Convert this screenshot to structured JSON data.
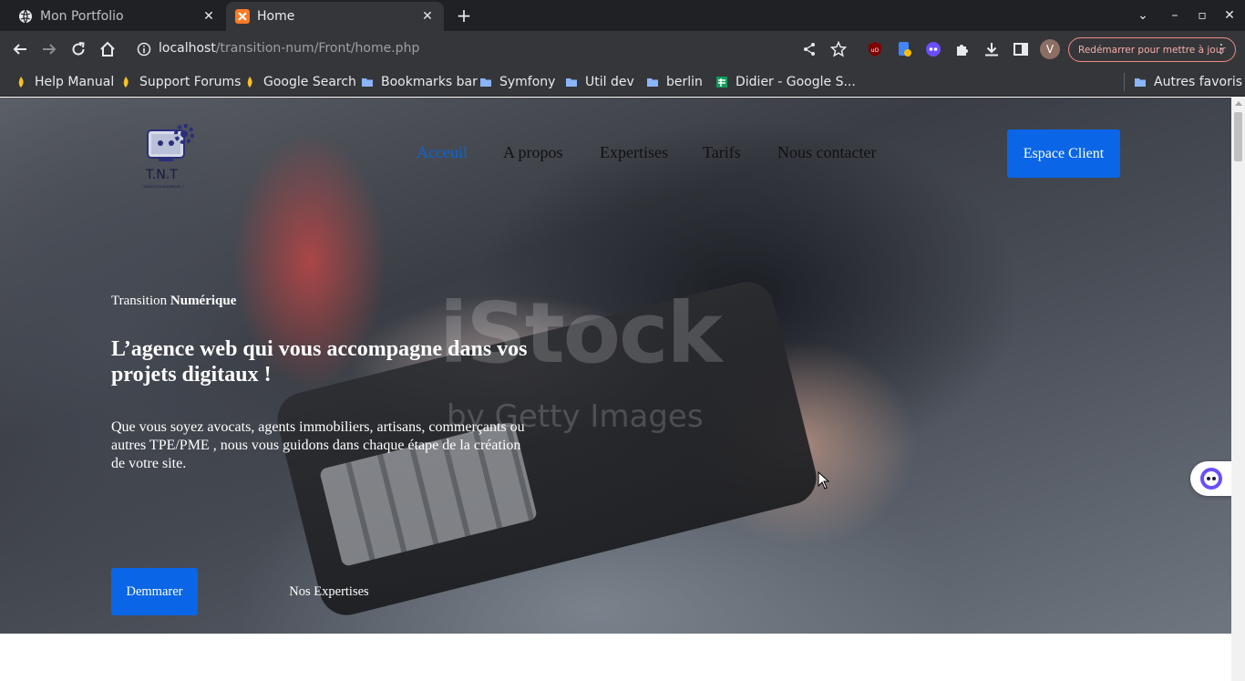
{
  "browser": {
    "tabs": [
      {
        "title": "Mon Portfolio",
        "active": false,
        "favicon": "globe-icon"
      },
      {
        "title": "Home",
        "active": true,
        "favicon": "xampp-icon"
      }
    ],
    "new_tab_symbol": "+",
    "address": {
      "host": "localhost",
      "path": "/transition-num/Front/home.php"
    },
    "restart_label": "Redémarrer pour mettre à jour",
    "profile_initial": "V",
    "bookmarks": [
      {
        "label": "Help Manual",
        "icon": "bookmark-flame-icon"
      },
      {
        "label": "Support Forums",
        "icon": "bookmark-flame-icon"
      },
      {
        "label": "Google Search",
        "icon": "bookmark-flame-icon"
      },
      {
        "label": "Bookmarks bar",
        "icon": "folder-icon"
      },
      {
        "label": "Symfony",
        "icon": "folder-icon"
      },
      {
        "label": "Util dev",
        "icon": "folder-icon"
      },
      {
        "label": "berlin",
        "icon": "folder-icon"
      },
      {
        "label": "Didier - Google S...",
        "icon": "sheets-icon"
      }
    ],
    "other_bookmarks": "Autres favoris"
  },
  "site": {
    "logo_text": "T.N.T",
    "logo_subtitle": "TRANSITION NUMÉRIQUE T",
    "nav": [
      {
        "label": "Acceuil",
        "active": true
      },
      {
        "label": "A propos",
        "active": false
      },
      {
        "label": "Expertises",
        "active": false
      },
      {
        "label": "Tarifs",
        "active": false
      },
      {
        "label": "Nous contacter",
        "active": false
      }
    ],
    "client_button": "Espace Client",
    "hero": {
      "eyebrow_regular": "Transition ",
      "eyebrow_bold": "Numérique",
      "headline": "L’agence web qui vous accompagne dans vos projets digitaux !",
      "description": "Que vous soyez avocats, agents immobiliers, artisans, commerçants ou autres TPE/PME , nous vous guidons dans chaque étape de la création de votre site.",
      "primary_button": "Demmarer",
      "secondary_button": "Nos Expertises",
      "watermark": "iStock",
      "watermark_sub": "by Getty Images"
    }
  },
  "colors": {
    "accent": "#0a66e6",
    "nav_active": "#0a66d8"
  }
}
